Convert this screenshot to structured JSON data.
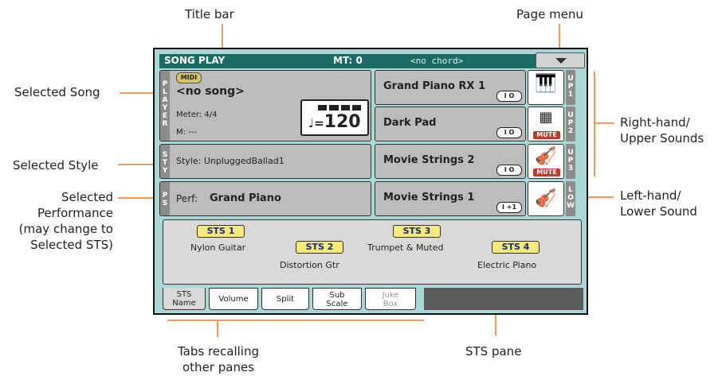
{
  "callouts": {
    "title_bar": "Title bar",
    "page_menu": "Page menu",
    "selected_song": "Selected Song",
    "selected_style": "Selected Style",
    "selected_performance": [
      "Selected",
      "Performance",
      "(may change to",
      "Selected STS)"
    ],
    "right_hand": [
      "Right-hand/",
      "Upper Sounds"
    ],
    "left_hand": [
      "Left-hand/",
      "Lower Sound"
    ],
    "tabs": [
      "Tabs recalling",
      "other panes"
    ],
    "sts_pane": "STS pane"
  },
  "titlebar": {
    "mode": "SONG PLAY",
    "mt": "MT: 0",
    "chord": "<no chord>"
  },
  "player": {
    "vert_label": [
      "P",
      "L",
      "A",
      "Y",
      "E",
      "R"
    ],
    "midi_badge": "MIDI",
    "song": "<no song>",
    "meter": "Meter: 4/4",
    "measure": "M: ---",
    "tempo_note": "♩=",
    "tempo": "120"
  },
  "style": {
    "vert_label": [
      "S",
      "T",
      "Y"
    ],
    "text": "Style: UnpluggedBallad1"
  },
  "perf": {
    "vert_label": [
      "P",
      "S"
    ],
    "label": "Perf:",
    "name": "Grand Piano"
  },
  "sounds": [
    {
      "name": "Grand Piano RX 1",
      "indicator": "I O",
      "icon": "piano-icon",
      "mute": "",
      "label": [
        "U",
        "P",
        "1"
      ]
    },
    {
      "name": "Dark Pad",
      "indicator": "I O",
      "icon": "synth-pad-icon",
      "mute": "MUTE",
      "label": [
        "U",
        "P",
        "2"
      ]
    },
    {
      "name": "Movie Strings 2",
      "indicator": "I O",
      "icon": "violin-icon",
      "mute": "MUTE",
      "label": [
        "U",
        "P",
        "3"
      ]
    },
    {
      "name": "Movie Strings 1",
      "indicator": "I +1",
      "icon": "violin-icon",
      "mute": "",
      "label": [
        "L",
        "O",
        "W"
      ]
    }
  ],
  "sts": [
    {
      "button": "STS 1",
      "name": "Nylon Guitar"
    },
    {
      "button": "STS 2",
      "name": "Distortion Gtr"
    },
    {
      "button": "STS 3",
      "name": "Trumpet & Muted"
    },
    {
      "button": "STS 4",
      "name": "Electric Piano"
    }
  ],
  "tabs": [
    {
      "label": [
        "STS",
        "Name"
      ],
      "state": "active"
    },
    {
      "label": [
        "Volume"
      ],
      "state": "normal"
    },
    {
      "label": [
        "Split"
      ],
      "state": "normal"
    },
    {
      "label": [
        "Sub",
        "Scale"
      ],
      "state": "normal"
    },
    {
      "label": [
        "Juke",
        "Box"
      ],
      "state": "disabled"
    }
  ]
}
